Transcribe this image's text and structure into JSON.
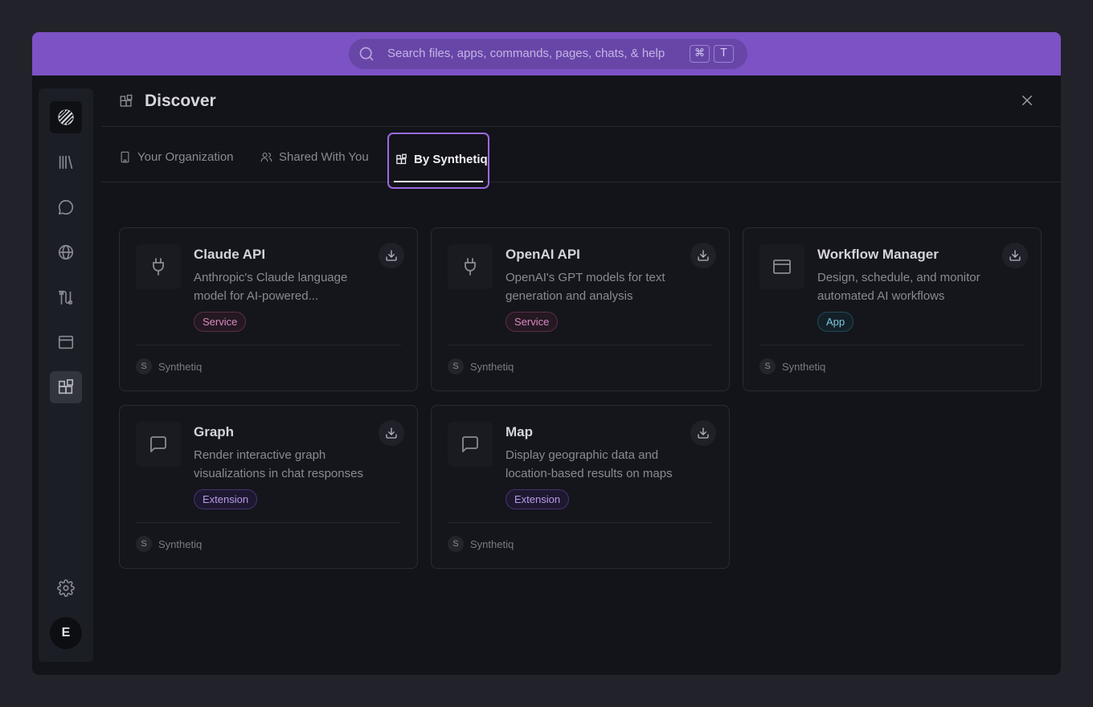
{
  "search": {
    "placeholder": "Search files, apps, commands, pages, chats, & help",
    "shortcut_keys": [
      "⌘",
      "T"
    ]
  },
  "sidebar": {
    "items": [
      {
        "name": "logo",
        "icon": "logo-stripes-icon"
      },
      {
        "name": "library",
        "icon": "library-icon"
      },
      {
        "name": "chat",
        "icon": "chat-icon"
      },
      {
        "name": "globe",
        "icon": "globe-icon"
      },
      {
        "name": "workflows",
        "icon": "route-icon"
      },
      {
        "name": "apps",
        "icon": "window-icon"
      },
      {
        "name": "discover",
        "icon": "blocks-icon",
        "active": true
      }
    ],
    "settings_icon": "gear-icon",
    "user_initial": "E"
  },
  "header": {
    "title": "Discover"
  },
  "tabs": [
    {
      "label": "Your Organization",
      "icon": "building-icon"
    },
    {
      "label": "Shared With You",
      "icon": "users-icon"
    },
    {
      "label": "By Synthetiq",
      "icon": "blocks-icon",
      "active": true
    }
  ],
  "cards": [
    {
      "title": "Claude API",
      "description": "Anthropic's Claude language model for AI-powered...",
      "badge": "Service",
      "icon": "plug-icon",
      "org_initial": "S",
      "org": "Synthetiq"
    },
    {
      "title": "OpenAI API",
      "description": "OpenAI's GPT models for text generation and analysis",
      "badge": "Service",
      "icon": "plug-icon",
      "org_initial": "S",
      "org": "Synthetiq"
    },
    {
      "title": "Workflow Manager",
      "description": "Design, schedule, and monitor automated AI workflows",
      "badge": "App",
      "icon": "window-icon",
      "org_initial": "S",
      "org": "Synthetiq"
    },
    {
      "title": "Graph",
      "description": "Render interactive graph visualizations in chat responses",
      "badge": "Extension",
      "icon": "message-square-icon",
      "org_initial": "S",
      "org": "Synthetiq"
    },
    {
      "title": "Map",
      "description": "Display geographic data and location-based results on maps",
      "badge": "Extension",
      "icon": "message-square-icon",
      "org_initial": "S",
      "org": "Synthetiq"
    }
  ],
  "colors": {
    "topbar": "#7c52c4",
    "active_tab_border": "#9b6ae0",
    "service_badge": "#d88ac0",
    "app_badge": "#7ec8dc",
    "extension_badge": "#b99ae8"
  }
}
